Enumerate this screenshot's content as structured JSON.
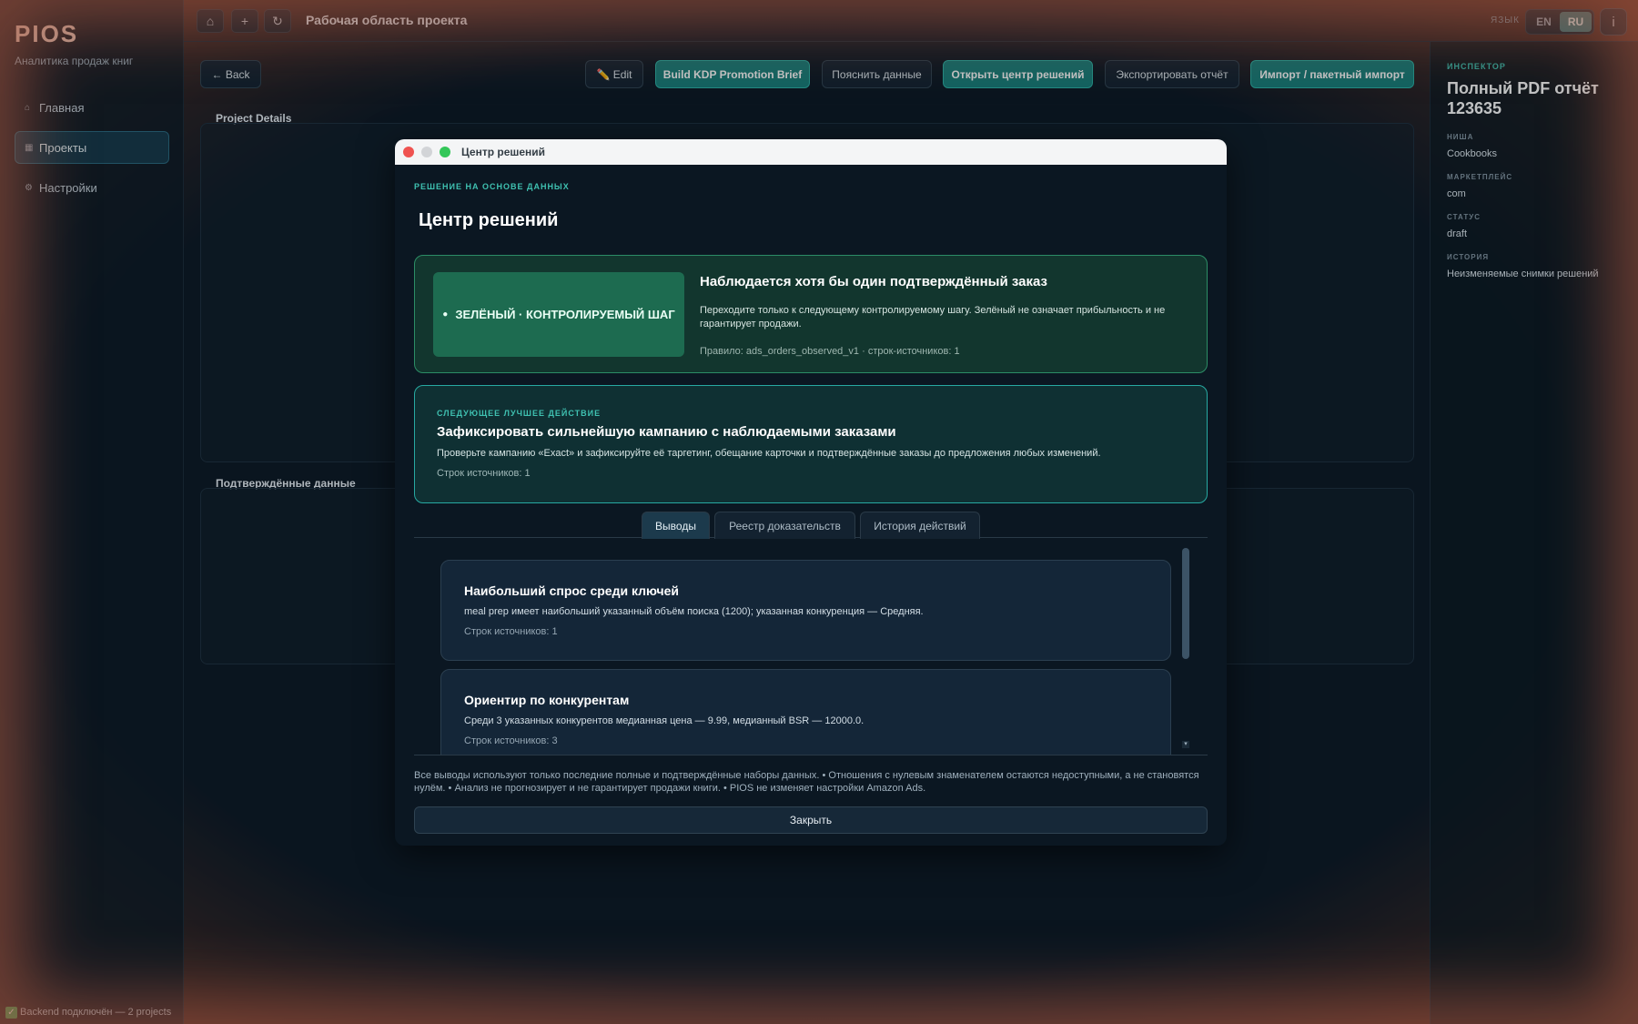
{
  "app": {
    "brand": "PIOS",
    "subtitle": "Аналитика продаж книг"
  },
  "sidebar": {
    "items": [
      {
        "icon": "⌂",
        "label": "Главная",
        "active": false
      },
      {
        "icon": "▦",
        "label": "Проекты",
        "active": true
      },
      {
        "icon": "⚙",
        "label": "Настройки",
        "active": false
      }
    ]
  },
  "topbar": {
    "icons": {
      "home": "⌂",
      "add": "+",
      "refresh": "↻"
    },
    "title": "Рабочая область проекта",
    "lang_label": "ЯЗЫК",
    "lang_en": "EN",
    "lang_ru": "RU",
    "info": "i"
  },
  "actions": {
    "back": "← Back",
    "edit": "✏️ Edit",
    "kdp": "Build KDP Promotion Brief",
    "explain": "Пояснить данные",
    "open_center": "Открыть центр решений",
    "export": "Экспортировать отчёт",
    "import": "Импорт / пакетный импорт"
  },
  "panels": {
    "project_details": "Project Details",
    "confirmed_data": "Подтверждённые данные"
  },
  "inspector": {
    "kicker": "ИНСПЕКТОР",
    "title": "Полный PDF отчёт 123635",
    "niche_label": "НИША",
    "niche": "Cookbooks",
    "market_label": "МАРКЕТПЛЕЙС",
    "market": "com",
    "status_label": "СТАТУС",
    "status": "draft",
    "history_label": "ИСТОРИЯ",
    "history": "Неизменяемые снимки решений"
  },
  "statusbar": {
    "icon": "✓",
    "text": "Backend подключён — 2 projects"
  },
  "modal": {
    "window_title": "Центр решений",
    "kicker": "РЕШЕНИЕ НА ОСНОВЕ ДАННЫХ",
    "heading": "Центр решений",
    "verdict": {
      "badge": "ЗЕЛЁНЫЙ · КОНТРОЛИРУЕМЫЙ ШАГ",
      "title": "Наблюдается хотя бы один подтверждённый заказ",
      "text": "Переходите только к следующему контролируемому шагу. Зелёный не означает прибыльность и не гарантирует продажи.",
      "rule": "Правило: ads_orders_observed_v1 · строк-источников: 1"
    },
    "next_action": {
      "kicker": "СЛЕДУЮЩЕЕ ЛУЧШЕЕ ДЕЙСТВИЕ",
      "title": "Зафиксировать сильнейшую кампанию с наблюдаемыми заказами",
      "text": "Проверьте кампанию «Exact» и зафиксируйте её таргетинг, обещание карточки и подтверждённые заказы до предложения любых изменений.",
      "sources": "Строк источников: 1"
    },
    "tabs": [
      {
        "label": "Выводы",
        "active": true
      },
      {
        "label": "Реестр доказательств",
        "active": false
      },
      {
        "label": "История действий",
        "active": false
      }
    ],
    "findings": [
      {
        "title": "Наибольший спрос среди ключей",
        "text": "meal prep имеет наибольший указанный объём поиска (1200); указанная конкуренция — Средняя.",
        "sources": "Строк источников: 1"
      },
      {
        "title": "Ориентир по конкурентам",
        "text": "Среди 3 указанных конкурентов медианная цена — 9.99, медианный BSR — 12000.0.",
        "sources": "Строк источников: 3"
      }
    ],
    "scroll_arrow": "▾",
    "footer": "Все выводы используют только последние полные и подтверждённые наборы данных.  •  Отношения с нулевым знаменателем остаются недоступными, а не становятся нулём.  •  Анализ не прогнозирует и не гарантирует продажи книги.  •  PIOS не изменяет настройки Amazon Ads.",
    "close": "Закрыть"
  },
  "colors": {
    "accent": "#3fc1b1",
    "primary_button": "#177f7b",
    "verdict_green": "#1d6b50",
    "window_close": "#ef5350",
    "window_min": "#d2d4d7",
    "window_max": "#34c759"
  }
}
